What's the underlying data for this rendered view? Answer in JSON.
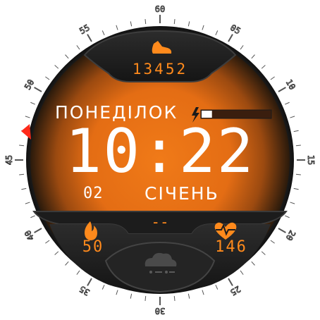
{
  "steps": {
    "value": "13452",
    "icon": "shoe-icon"
  },
  "date": {
    "day_name": "ПОНЕДІЛОК",
    "day_number": "02",
    "month": "СІЧЕНЬ"
  },
  "time": {
    "display": "10:22"
  },
  "battery": {
    "level": 0.15,
    "icon": "lightning-icon"
  },
  "bottom_complication": {
    "value": "--"
  },
  "calories": {
    "value": "50",
    "icon": "flame-icon"
  },
  "heart_rate": {
    "value": "146",
    "icon": "heart-rate-icon"
  },
  "weather": {
    "icon": "cloud-snow-icon"
  },
  "bezel": {
    "numbers": [
      "60",
      "05",
      "10",
      "15",
      "20",
      "25",
      "30",
      "35",
      "40",
      "45",
      "50",
      "55"
    ]
  },
  "colors": {
    "accent": "#ff8a1c",
    "dial_center": "#f07a18",
    "dial_edge": "#2a1a0c",
    "panel": "#1e1e1e",
    "marker": "#ff2a1a"
  }
}
